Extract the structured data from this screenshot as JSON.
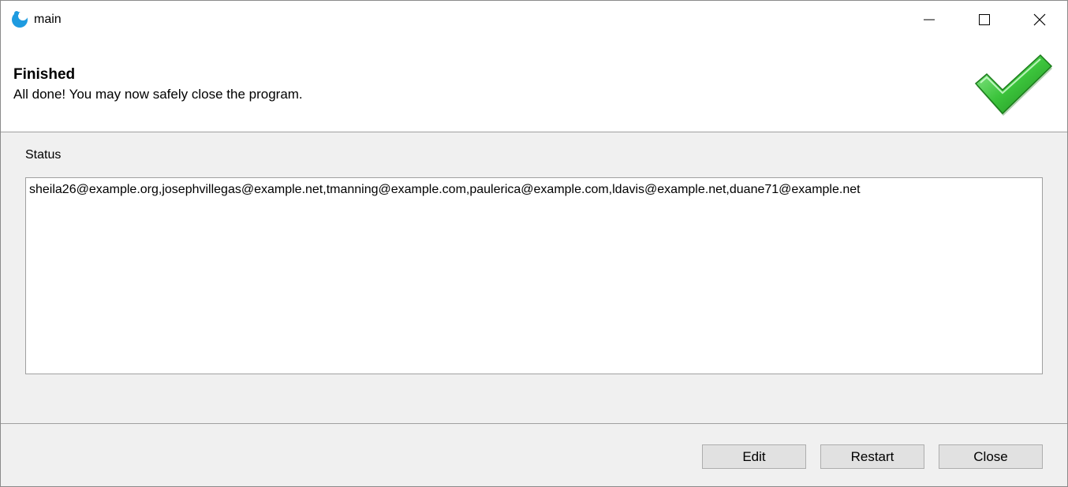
{
  "window": {
    "title": "main",
    "icon": "app-logo-icon",
    "controls": {
      "minimize_icon": "minimize-icon",
      "maximize_icon": "maximize-icon",
      "close_icon": "close-icon"
    }
  },
  "banner": {
    "title": "Finished",
    "subtitle": "All done! You may now safely close the program.",
    "icon": "green-checkmark-icon"
  },
  "status": {
    "label": "Status",
    "text": "sheila26@example.org,josephvillegas@example.net,tmanning@example.com,paulerica@example.com,ldavis@example.net,duane71@example.net"
  },
  "buttons": {
    "edit": "Edit",
    "restart": "Restart",
    "close": "Close"
  },
  "colors": {
    "checkmark": "#3cc43c",
    "app_icon": "#1e9be0"
  }
}
